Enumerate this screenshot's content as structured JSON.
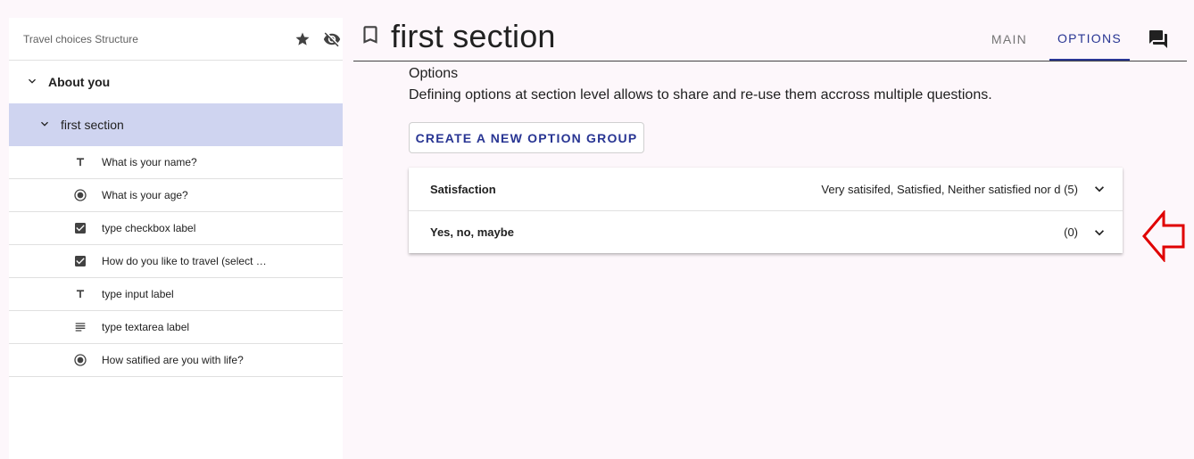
{
  "sidebar": {
    "title": "Travel choices Structure",
    "icons": [
      "star-icon",
      "visibility-off-icon"
    ],
    "tree": {
      "group_label": "About you",
      "section_label": "first section",
      "questions": [
        {
          "icon": "text-type-icon",
          "label": "What is your name?"
        },
        {
          "icon": "radio-icon",
          "label": "What is your age?"
        },
        {
          "icon": "checkbox-icon",
          "label": "type checkbox label"
        },
        {
          "icon": "checkbox-icon",
          "label": "How do you like to travel (select …"
        },
        {
          "icon": "text-type-icon",
          "label": "type input label"
        },
        {
          "icon": "textarea-icon",
          "label": "type textarea label"
        },
        {
          "icon": "radio-icon",
          "label": "How satified are you with life?"
        }
      ]
    }
  },
  "header": {
    "title": "first section",
    "tabs": [
      {
        "label": "MAIN",
        "active": false
      },
      {
        "label": "OPTIONS",
        "active": true
      }
    ]
  },
  "main": {
    "heading": "Options",
    "description": "Defining options at section level allows to share and re-use them accross multiple questions.",
    "create_button": "CREATE A NEW OPTION GROUP",
    "option_groups": [
      {
        "name": "Satisfaction",
        "summary": "Very satisifed, Satisfied, Neither satisfied nor d (5)"
      },
      {
        "name": "Yes, no, maybe",
        "summary": "(0)"
      }
    ]
  },
  "colors": {
    "accent": "#283593",
    "selected_bg": "#cfd4f0",
    "page_bg": "#fdf7fb",
    "annotation_arrow": "#e00000"
  }
}
